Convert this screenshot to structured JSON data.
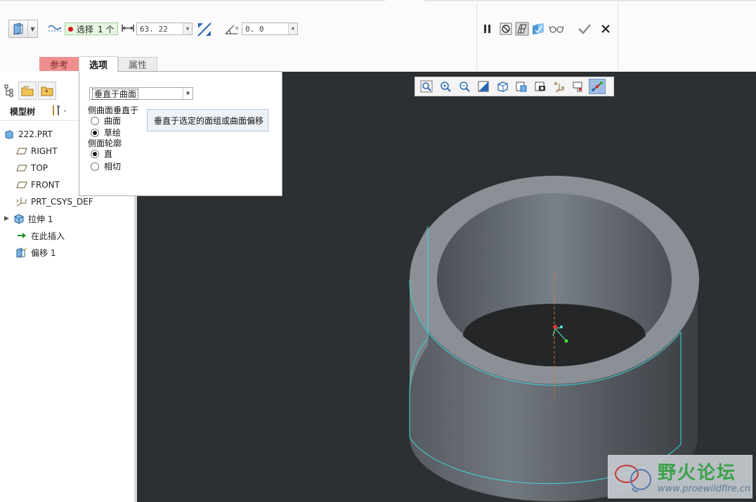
{
  "dashboard": {
    "select_label": "选择",
    "select_count": "1 个",
    "distance_value": "63. 22",
    "angle_value": "0. 0",
    "tabs": [
      {
        "label": "参考"
      },
      {
        "label": "选项"
      },
      {
        "label": "属性"
      }
    ]
  },
  "options_panel": {
    "offset_dropdown": "垂直于曲面",
    "side_normal_label": "侧曲面垂直于",
    "side_normal_options": [
      "曲面",
      "草绘"
    ],
    "side_normal_selected": "草绘",
    "side_profile_label": "侧面轮廓",
    "side_profile_options": [
      "直",
      "相切"
    ],
    "side_profile_selected": "直",
    "tooltip": "垂直于选定的面组或曲面偏移"
  },
  "navigator": {
    "header": "模型树",
    "tree": [
      {
        "label": "222.PRT",
        "icon": "part-icon"
      },
      {
        "label": "RIGHT",
        "icon": "datum-plane-icon"
      },
      {
        "label": "TOP",
        "icon": "datum-plane-icon"
      },
      {
        "label": "FRONT",
        "icon": "datum-plane-icon"
      },
      {
        "label": "PRT_CSYS_DEF",
        "icon": "csys-icon"
      },
      {
        "label": "拉伸 1",
        "icon": "extrude-icon"
      },
      {
        "label": "在此插入",
        "icon": "insert-here-arrow-icon"
      },
      {
        "label": "偏移 1",
        "icon": "offset-feature-icon"
      }
    ]
  },
  "watermark": {
    "title": "野火论坛",
    "url": "www.proewildfire.cn"
  },
  "colors": {
    "graphics_bg": "#2d3032",
    "reference_tab": "#f08d8d",
    "select_box": "#e6f6e3",
    "highlight_edge": "#3fd6d6"
  }
}
